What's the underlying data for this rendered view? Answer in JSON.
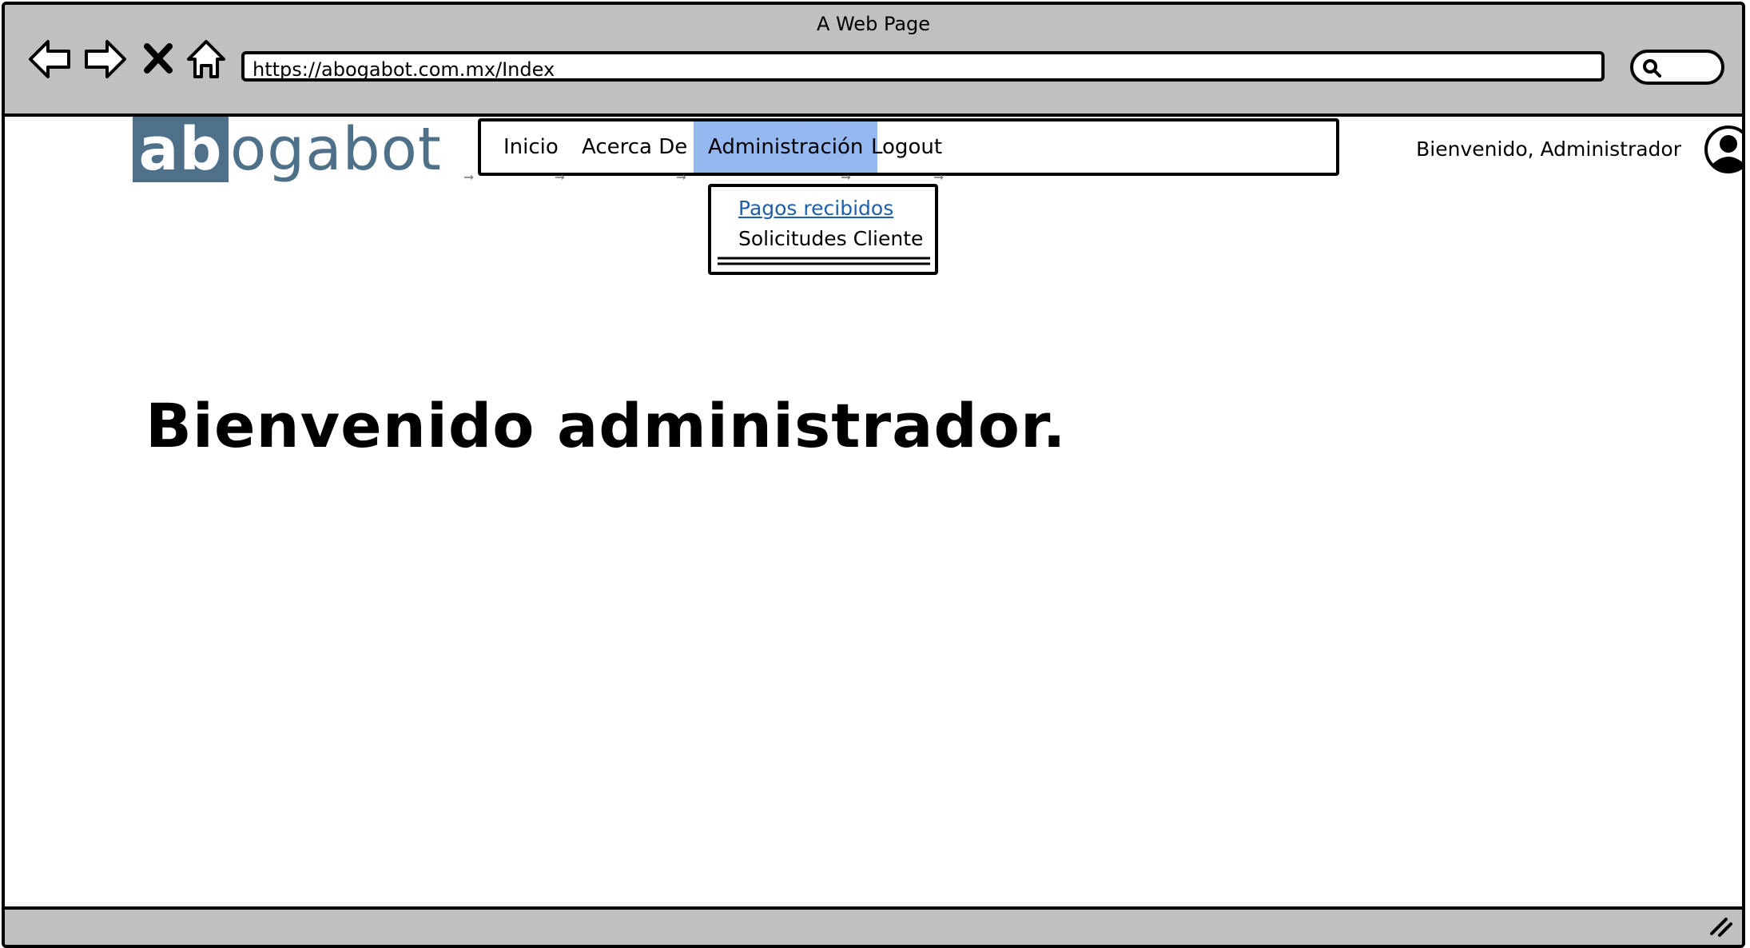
{
  "window": {
    "title": "A Web Page"
  },
  "browser": {
    "url": "https://abogabot.com.mx/Index",
    "icons": [
      "back-arrow-icon",
      "forward-arrow-icon",
      "close-icon",
      "home-icon",
      "search-icon"
    ]
  },
  "logo": {
    "highlight": "ab",
    "rest": "ogabot",
    "color": "#4e7189"
  },
  "menu": {
    "items": [
      {
        "label": "Inicio"
      },
      {
        "label": "Acerca De"
      },
      {
        "label": "Administración",
        "active": true
      },
      {
        "label": "Logout"
      }
    ],
    "active_color": "#96b8f0"
  },
  "dropdown": {
    "items": [
      {
        "label": "Pagos recibidos",
        "style": "link"
      },
      {
        "label": "Solicitudes Cliente"
      }
    ]
  },
  "user": {
    "greeting": "Bienvenido, Administrador",
    "icon": "user-avatar-icon"
  },
  "main": {
    "heading": "Bienvenido administrador."
  }
}
